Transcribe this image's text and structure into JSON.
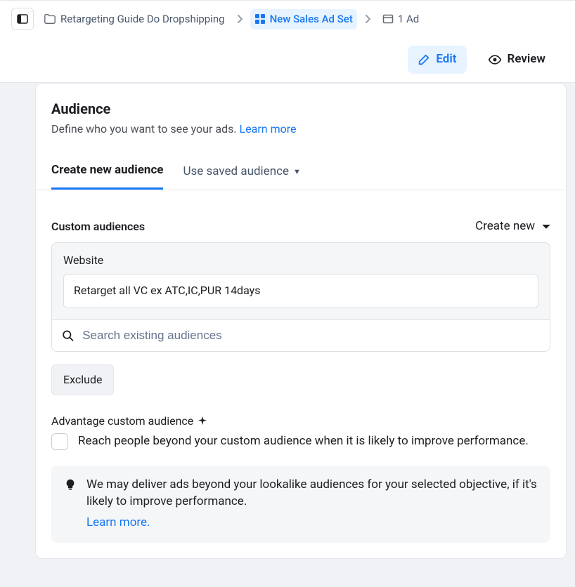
{
  "breadcrumb": {
    "campaign": "Retargeting Guide Do Dropshipping",
    "adset": "New Sales Ad Set",
    "ad": "1 Ad"
  },
  "toolbar": {
    "edit": "Edit",
    "review": "Review"
  },
  "audience": {
    "title": "Audience",
    "subtitle": "Define who you want to see your ads. ",
    "learn_more": "Learn more",
    "tabs": {
      "create": "Create new audience",
      "saved": "Use saved audience"
    },
    "custom_label": "Custom audiences",
    "create_new": "Create new",
    "source_label": "Website",
    "selected_audience": "Retarget all VC ex ATC,IC,PUR 14days",
    "search_placeholder": "Search existing audiences",
    "exclude_btn": "Exclude",
    "advantage_label": "Advantage custom audience",
    "advantage_sub": "Reach people beyond your custom audience when it is likely to improve performance.",
    "info_msg": "We may deliver ads beyond your lookalike audiences for your selected objective, if it's likely to improve performance.",
    "info_link": "Learn more."
  }
}
